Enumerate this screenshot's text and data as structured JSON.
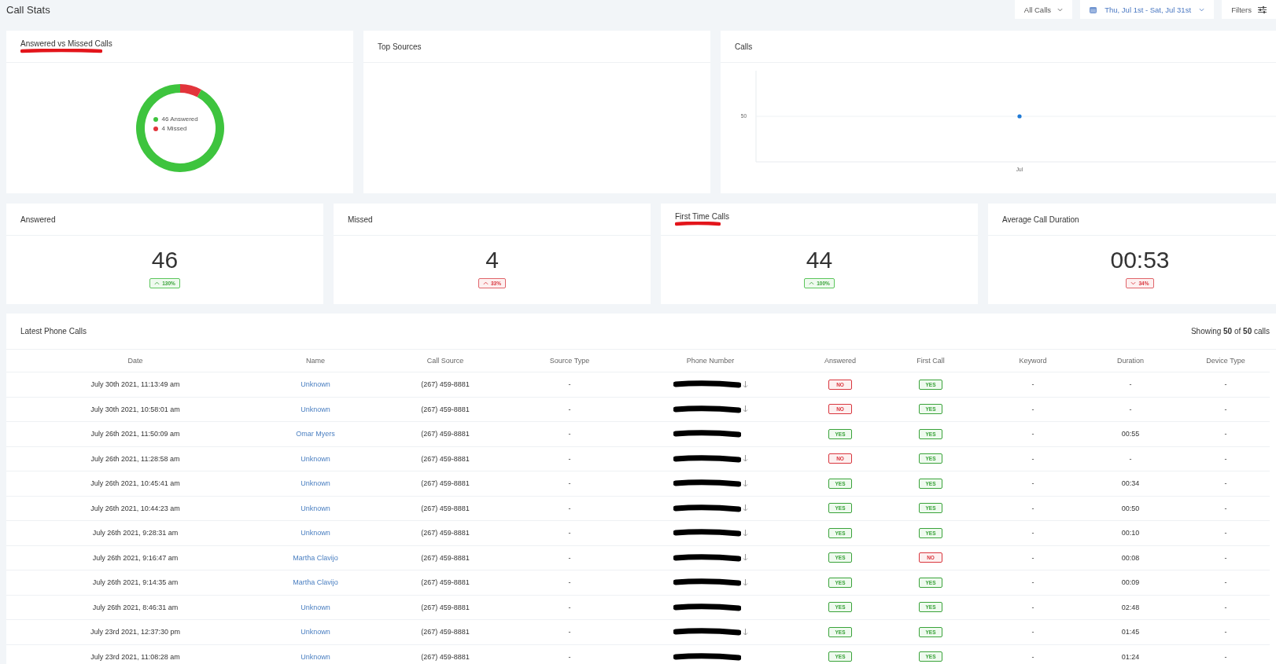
{
  "header": {
    "title": "Call Stats",
    "call_filter": "All Calls",
    "date_range": "Thu, Jul 1st - Sat, Jul 31st",
    "filters_label": "Filters"
  },
  "top_cards": [
    {
      "kind": "donut",
      "title": "Answered vs Missed Calls",
      "underlined": true,
      "legend": [
        {
          "count": "46",
          "label": "Answered",
          "color": "#3ec43e"
        },
        {
          "count": "4",
          "label": "Missed",
          "color": "#e2343b"
        }
      ]
    },
    {
      "kind": "empty",
      "title": "Top Sources",
      "underlined": false
    },
    {
      "kind": "line",
      "title": "Calls",
      "underlined": false,
      "y_tick": "50",
      "x_tick": "Jul"
    }
  ],
  "stats": [
    {
      "title": "Answered",
      "underlined": false,
      "value": "46",
      "change": "130%",
      "up": true,
      "positive": true
    },
    {
      "title": "Missed",
      "underlined": false,
      "value": "4",
      "change": "33%",
      "up": true,
      "positive": false
    },
    {
      "title": "First Time Calls",
      "underlined": true,
      "value": "44",
      "change": "100%",
      "up": true,
      "positive": true
    },
    {
      "title": "Average Call Duration",
      "underlined": false,
      "value": "00:53",
      "change": "34%",
      "up": false,
      "positive": false
    }
  ],
  "table": {
    "title": "Latest Phone Calls",
    "showing": "Showing **50** of **50** calls",
    "columns": [
      "Date",
      "Name",
      "Call Source",
      "Source Type",
      "Phone Number",
      "Answered",
      "First Call",
      "Keyword",
      "Duration",
      "Device Type"
    ],
    "rows": [
      {
        "date": "July 30th 2021, 11:13:49 am",
        "name": "Unknown",
        "source": "(267) 459-8881",
        "source_type": "-",
        "arrow": true,
        "answered": {
          "label": "NO",
          "positive": false
        },
        "first_call": {
          "label": "YES",
          "positive": true
        },
        "keyword": "-",
        "duration": "-",
        "device_type": "-"
      },
      {
        "date": "July 30th 2021, 10:58:01 am",
        "name": "Unknown",
        "source": "(267) 459-8881",
        "source_type": "-",
        "arrow": true,
        "answered": {
          "label": "NO",
          "positive": false
        },
        "first_call": {
          "label": "YES",
          "positive": true
        },
        "keyword": "-",
        "duration": "-",
        "device_type": "-"
      },
      {
        "date": "July 26th 2021, 11:50:09 am",
        "name": "Omar Myers",
        "source": "(267) 459-8881",
        "source_type": "-",
        "arrow": false,
        "answered": {
          "label": "YES",
          "positive": true
        },
        "first_call": {
          "label": "YES",
          "positive": true
        },
        "keyword": "-",
        "duration": "00:55",
        "device_type": "-"
      },
      {
        "date": "July 26th 2021, 11:28:58 am",
        "name": "Unknown",
        "source": "(267) 459-8881",
        "source_type": "-",
        "arrow": true,
        "answered": {
          "label": "NO",
          "positive": false
        },
        "first_call": {
          "label": "YES",
          "positive": true
        },
        "keyword": "-",
        "duration": "-",
        "device_type": "-"
      },
      {
        "date": "July 26th 2021, 10:45:41 am",
        "name": "Unknown",
        "source": "(267) 459-8881",
        "source_type": "-",
        "arrow": true,
        "answered": {
          "label": "YES",
          "positive": true
        },
        "first_call": {
          "label": "YES",
          "positive": true
        },
        "keyword": "-",
        "duration": "00:34",
        "device_type": "-"
      },
      {
        "date": "July 26th 2021, 10:44:23 am",
        "name": "Unknown",
        "source": "(267) 459-8881",
        "source_type": "-",
        "arrow": true,
        "answered": {
          "label": "YES",
          "positive": true
        },
        "first_call": {
          "label": "YES",
          "positive": true
        },
        "keyword": "-",
        "duration": "00:50",
        "device_type": "-"
      },
      {
        "date": "July 26th 2021, 9:28:31 am",
        "name": "Unknown",
        "source": "(267) 459-8881",
        "source_type": "-",
        "arrow": true,
        "answered": {
          "label": "YES",
          "positive": true
        },
        "first_call": {
          "label": "YES",
          "positive": true
        },
        "keyword": "-",
        "duration": "00:10",
        "device_type": "-"
      },
      {
        "date": "July 26th 2021, 9:16:47 am",
        "name": "Martha Clavijo",
        "source": "(267) 459-8881",
        "source_type": "-",
        "arrow": true,
        "answered": {
          "label": "YES",
          "positive": true
        },
        "first_call": {
          "label": "NO",
          "positive": false
        },
        "keyword": "-",
        "duration": "00:08",
        "device_type": "-"
      },
      {
        "date": "July 26th 2021, 9:14:35 am",
        "name": "Martha Clavijo",
        "source": "(267) 459-8881",
        "source_type": "-",
        "arrow": true,
        "answered": {
          "label": "YES",
          "positive": true
        },
        "first_call": {
          "label": "YES",
          "positive": true
        },
        "keyword": "-",
        "duration": "00:09",
        "device_type": "-"
      },
      {
        "date": "July 26th 2021, 8:46:31 am",
        "name": "Unknown",
        "source": "(267) 459-8881",
        "source_type": "-",
        "arrow": false,
        "answered": {
          "label": "YES",
          "positive": true
        },
        "first_call": {
          "label": "YES",
          "positive": true
        },
        "keyword": "-",
        "duration": "02:48",
        "device_type": "-"
      },
      {
        "date": "July 23rd 2021, 12:37:30 pm",
        "name": "Unknown",
        "source": "(267) 459-8881",
        "source_type": "-",
        "arrow": true,
        "answered": {
          "label": "YES",
          "positive": true
        },
        "first_call": {
          "label": "YES",
          "positive": true
        },
        "keyword": "-",
        "duration": "01:45",
        "device_type": "-"
      },
      {
        "date": "July 23rd 2021, 11:08:28 am",
        "name": "Unknown",
        "source": "(267) 459-8881",
        "source_type": "-",
        "arrow": false,
        "answered": {
          "label": "YES",
          "positive": true
        },
        "first_call": {
          "label": "YES",
          "positive": true
        },
        "keyword": "-",
        "duration": "01:24",
        "device_type": "-"
      }
    ]
  }
}
